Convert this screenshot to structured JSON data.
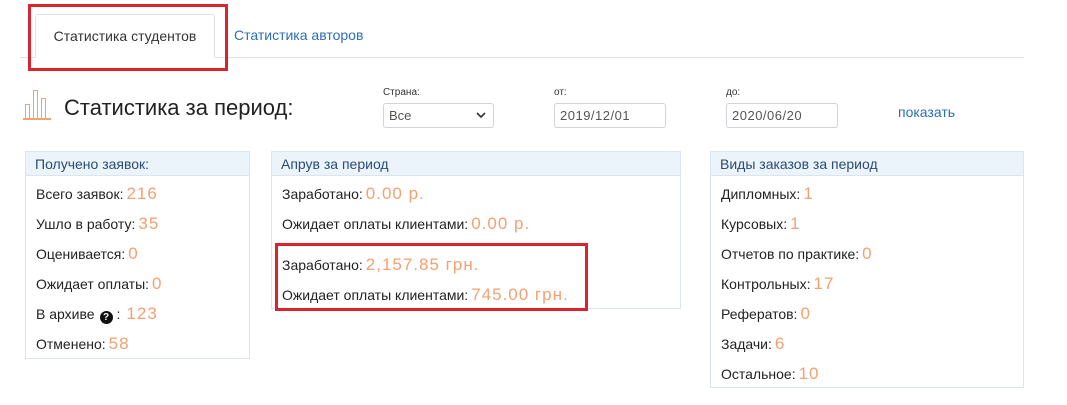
{
  "tabs": {
    "students_label": "Статистика студентов",
    "authors_label": "Статистика авторов"
  },
  "header": {
    "title": "Статистика за период:",
    "icon": "bar-chart-icon",
    "accent_color": "#f5a070"
  },
  "filters": {
    "country_label": "Страна:",
    "country_value": "Все",
    "from_label": "от:",
    "from_value": "2019/12/01",
    "to_label": "до:",
    "to_value": "2020/06/20",
    "show_label": "показать"
  },
  "received": {
    "title": "Получено заявок:",
    "total_label": "Всего заявок:",
    "total_value": "216",
    "in_work_label": "Ушло в работу:",
    "in_work_value": "35",
    "evaluating_label": "Оценивается:",
    "evaluating_value": "0",
    "awaiting_label": "Ожидает оплаты:",
    "awaiting_value": "0",
    "archive_label": "В архиве",
    "archive_sep": ":",
    "archive_value": "123",
    "cancelled_label": "Отменено:",
    "cancelled_value": "58"
  },
  "approve": {
    "title": "Апрув за период",
    "earned_label": "Заработано:",
    "earned_rub": "0.00 р.",
    "awaiting_label": "Ожидает оплаты клиентами:",
    "awaiting_rub": "0.00 р.",
    "earned_uah_label": "Заработано:",
    "earned_uah": "2,157.85 грн.",
    "awaiting_uah_label": "Ожидает оплаты клиентами:",
    "awaiting_uah": "745.00 грн."
  },
  "order_types": {
    "title": "Виды заказов за период",
    "diploma_label": "Дипломных:",
    "diploma_value": "1",
    "course_label": "Курсовых:",
    "course_value": "1",
    "practice_label": "Отчетов по практике:",
    "practice_value": "0",
    "control_label": "Контрольных:",
    "control_value": "17",
    "essay_label": "Рефератов:",
    "essay_value": "0",
    "tasks_label": "Задачи:",
    "tasks_value": "6",
    "other_label": "Остальное:",
    "other_value": "10"
  },
  "colors": {
    "highlight": "#d9232e",
    "link": "#2b6fb5",
    "panel_header": "#ebf3fb"
  }
}
